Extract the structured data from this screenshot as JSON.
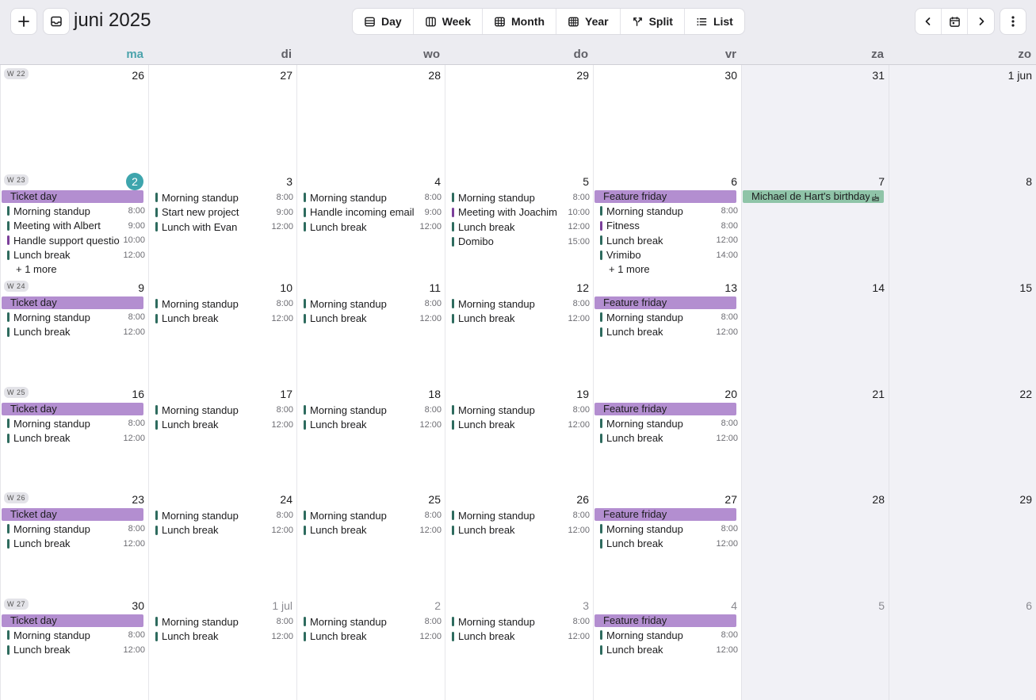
{
  "header": {
    "title": "juni 2025",
    "views": [
      "Day",
      "Week",
      "Month",
      "Year",
      "Split",
      "List"
    ]
  },
  "weekdays": [
    "ma",
    "di",
    "wo",
    "do",
    "vr",
    "za",
    "zo"
  ],
  "colors": {
    "accent": "#3ea5ad",
    "allday_purple": "#b38ed0",
    "allday_green": "#8fc4a8",
    "event_bar_green": "#2e6b5e",
    "event_bar_purple": "#7b3f9a"
  },
  "weeks": [
    {
      "label": "W 22",
      "days": [
        {
          "num": "26",
          "events": []
        },
        {
          "num": "27",
          "events": []
        },
        {
          "num": "28",
          "events": []
        },
        {
          "num": "29",
          "events": []
        },
        {
          "num": "30",
          "events": []
        },
        {
          "num": "31",
          "events": []
        },
        {
          "num": "1 jun",
          "events": []
        }
      ]
    },
    {
      "label": "W 23",
      "days": [
        {
          "num": "2",
          "today": true,
          "allday": [
            {
              "title": "Ticket day",
              "color": "purple"
            }
          ],
          "events": [
            {
              "title": "Morning standup",
              "time": "8:00"
            },
            {
              "title": "Meeting with Albert",
              "time": "9:00"
            },
            {
              "title": "Handle support questions",
              "time": "10:00",
              "color": "purple"
            },
            {
              "title": "Lunch break",
              "time": "12:00"
            }
          ],
          "more": "+ 1 more"
        },
        {
          "num": "3",
          "events": [
            {
              "title": "Morning standup",
              "time": "8:00"
            },
            {
              "title": "Start new project",
              "time": "9:00"
            },
            {
              "title": "Lunch with Evan",
              "time": "12:00"
            }
          ]
        },
        {
          "num": "4",
          "events": [
            {
              "title": "Morning standup",
              "time": "8:00"
            },
            {
              "title": "Handle incoming email",
              "time": "9:00"
            },
            {
              "title": "Lunch break",
              "time": "12:00"
            }
          ]
        },
        {
          "num": "5",
          "events": [
            {
              "title": "Morning standup",
              "time": "8:00"
            },
            {
              "title": "Meeting with Joachim",
              "time": "10:00",
              "color": "purple"
            },
            {
              "title": "Lunch break",
              "time": "12:00"
            },
            {
              "title": "Domibo",
              "time": "15:00"
            }
          ]
        },
        {
          "num": "6",
          "allday": [
            {
              "title": "Feature friday",
              "color": "purple"
            }
          ],
          "events": [
            {
              "title": "Morning standup",
              "time": "8:00"
            },
            {
              "title": "Fitness",
              "time": "8:00",
              "color": "purple"
            },
            {
              "title": "Lunch break",
              "time": "12:00"
            },
            {
              "title": "Vrimibo",
              "time": "14:00"
            }
          ],
          "more": "+ 1 more"
        },
        {
          "num": "7",
          "allday": [
            {
              "title": "Michael de Hart's birthday",
              "color": "green",
              "icon": "cake-icon"
            }
          ],
          "events": []
        },
        {
          "num": "8",
          "events": []
        }
      ]
    },
    {
      "label": "W 24",
      "days": [
        {
          "num": "9",
          "allday": [
            {
              "title": "Ticket day",
              "color": "purple"
            }
          ],
          "events": [
            {
              "title": "Morning standup",
              "time": "8:00"
            },
            {
              "title": "Lunch break",
              "time": "12:00"
            }
          ]
        },
        {
          "num": "10",
          "events": [
            {
              "title": "Morning standup",
              "time": "8:00"
            },
            {
              "title": "Lunch break",
              "time": "12:00"
            }
          ]
        },
        {
          "num": "11",
          "events": [
            {
              "title": "Morning standup",
              "time": "8:00"
            },
            {
              "title": "Lunch break",
              "time": "12:00"
            }
          ]
        },
        {
          "num": "12",
          "events": [
            {
              "title": "Morning standup",
              "time": "8:00"
            },
            {
              "title": "Lunch break",
              "time": "12:00"
            }
          ]
        },
        {
          "num": "13",
          "allday": [
            {
              "title": "Feature friday",
              "color": "purple"
            }
          ],
          "events": [
            {
              "title": "Morning standup",
              "time": "8:00"
            },
            {
              "title": "Lunch break",
              "time": "12:00"
            }
          ]
        },
        {
          "num": "14",
          "events": []
        },
        {
          "num": "15",
          "events": []
        }
      ]
    },
    {
      "label": "W 25",
      "days": [
        {
          "num": "16",
          "allday": [
            {
              "title": "Ticket day",
              "color": "purple"
            }
          ],
          "events": [
            {
              "title": "Morning standup",
              "time": "8:00"
            },
            {
              "title": "Lunch break",
              "time": "12:00"
            }
          ]
        },
        {
          "num": "17",
          "events": [
            {
              "title": "Morning standup",
              "time": "8:00"
            },
            {
              "title": "Lunch break",
              "time": "12:00"
            }
          ]
        },
        {
          "num": "18",
          "events": [
            {
              "title": "Morning standup",
              "time": "8:00"
            },
            {
              "title": "Lunch break",
              "time": "12:00"
            }
          ]
        },
        {
          "num": "19",
          "events": [
            {
              "title": "Morning standup",
              "time": "8:00"
            },
            {
              "title": "Lunch break",
              "time": "12:00"
            }
          ]
        },
        {
          "num": "20",
          "allday": [
            {
              "title": "Feature friday",
              "color": "purple"
            }
          ],
          "events": [
            {
              "title": "Morning standup",
              "time": "8:00"
            },
            {
              "title": "Lunch break",
              "time": "12:00"
            }
          ]
        },
        {
          "num": "21",
          "events": []
        },
        {
          "num": "22",
          "events": []
        }
      ]
    },
    {
      "label": "W 26",
      "days": [
        {
          "num": "23",
          "allday": [
            {
              "title": "Ticket day",
              "color": "purple"
            }
          ],
          "events": [
            {
              "title": "Morning standup",
              "time": "8:00"
            },
            {
              "title": "Lunch break",
              "time": "12:00"
            }
          ]
        },
        {
          "num": "24",
          "events": [
            {
              "title": "Morning standup",
              "time": "8:00"
            },
            {
              "title": "Lunch break",
              "time": "12:00"
            }
          ]
        },
        {
          "num": "25",
          "events": [
            {
              "title": "Morning standup",
              "time": "8:00"
            },
            {
              "title": "Lunch break",
              "time": "12:00"
            }
          ]
        },
        {
          "num": "26",
          "events": [
            {
              "title": "Morning standup",
              "time": "8:00"
            },
            {
              "title": "Lunch break",
              "time": "12:00"
            }
          ]
        },
        {
          "num": "27",
          "allday": [
            {
              "title": "Feature friday",
              "color": "purple"
            }
          ],
          "events": [
            {
              "title": "Morning standup",
              "time": "8:00"
            },
            {
              "title": "Lunch break",
              "time": "12:00"
            }
          ]
        },
        {
          "num": "28",
          "events": []
        },
        {
          "num": "29",
          "events": []
        }
      ]
    },
    {
      "label": "W 27",
      "days": [
        {
          "num": "30",
          "allday": [
            {
              "title": "Ticket day",
              "color": "purple"
            }
          ],
          "events": [
            {
              "title": "Morning standup",
              "time": "8:00"
            },
            {
              "title": "Lunch break",
              "time": "12:00"
            }
          ]
        },
        {
          "num": "1 jul",
          "muted": true,
          "events": [
            {
              "title": "Morning standup",
              "time": "8:00"
            },
            {
              "title": "Lunch break",
              "time": "12:00"
            }
          ]
        },
        {
          "num": "2",
          "muted": true,
          "events": [
            {
              "title": "Morning standup",
              "time": "8:00"
            },
            {
              "title": "Lunch break",
              "time": "12:00"
            }
          ]
        },
        {
          "num": "3",
          "muted": true,
          "events": [
            {
              "title": "Morning standup",
              "time": "8:00"
            },
            {
              "title": "Lunch break",
              "time": "12:00"
            }
          ]
        },
        {
          "num": "4",
          "muted": true,
          "allday": [
            {
              "title": "Feature friday",
              "color": "purple"
            }
          ],
          "events": [
            {
              "title": "Morning standup",
              "time": "8:00"
            },
            {
              "title": "Lunch break",
              "time": "12:00"
            }
          ]
        },
        {
          "num": "5",
          "muted": true,
          "events": []
        },
        {
          "num": "6",
          "muted": true,
          "events": []
        }
      ]
    }
  ]
}
